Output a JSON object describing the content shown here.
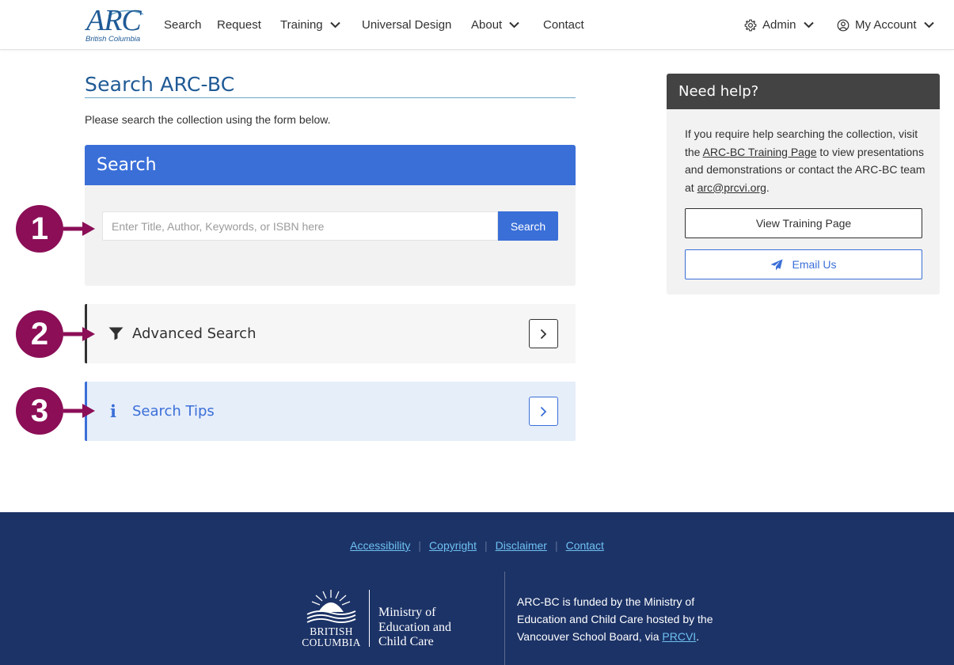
{
  "header": {
    "logo": {
      "text": "ARC",
      "subtitle": "British Columbia"
    },
    "nav": [
      {
        "label": "Search"
      },
      {
        "label": "Request"
      },
      {
        "label": "Training"
      },
      {
        "label": "Universal Design"
      },
      {
        "label": "About"
      },
      {
        "label": "Contact"
      }
    ],
    "admin_label": "Admin",
    "account_label": "My Account"
  },
  "main": {
    "title": "Search ARC-BC",
    "intro": "Please search the collection using the form below.",
    "search_card": {
      "heading": "Search",
      "input_placeholder": "Enter Title, Author, Keywords, or ISBN here",
      "input_value": "",
      "button_label": "Search"
    },
    "advanced": {
      "label": "Advanced Search"
    },
    "tips": {
      "label": "Search Tips"
    }
  },
  "callouts": [
    "1",
    "2",
    "3"
  ],
  "help": {
    "heading": "Need help?",
    "text_1": "If you require help searching the collection, visit the ",
    "link_training": "ARC-BC Training Page",
    "text_2": " to view presentations and demonstrations or contact the ARC-BC team at ",
    "link_email": "arc@prcvi.org",
    "text_3": ".",
    "btn_training": "View Training Page",
    "btn_email": "Email Us"
  },
  "footer": {
    "links": [
      "Accessibility",
      "Copyright",
      "Disclaimer",
      "Contact"
    ],
    "bc_name_1": "BRITISH",
    "bc_name_2": "COLUMBIA",
    "ministry_1": "Ministry of",
    "ministry_2": "Education and",
    "ministry_3": "Child Care",
    "funding_text": "ARC-BC is funded by the Ministry of Education and Child Care hosted by the Vancouver School Board, via ",
    "funding_link": "PRCVI",
    "funding_end": "."
  },
  "colors": {
    "brand_blue": "#3a6fd8",
    "title_blue": "#1f5a96",
    "callout": "#8b0e57",
    "footer_bg": "#1c3367",
    "help_head": "#434343"
  }
}
